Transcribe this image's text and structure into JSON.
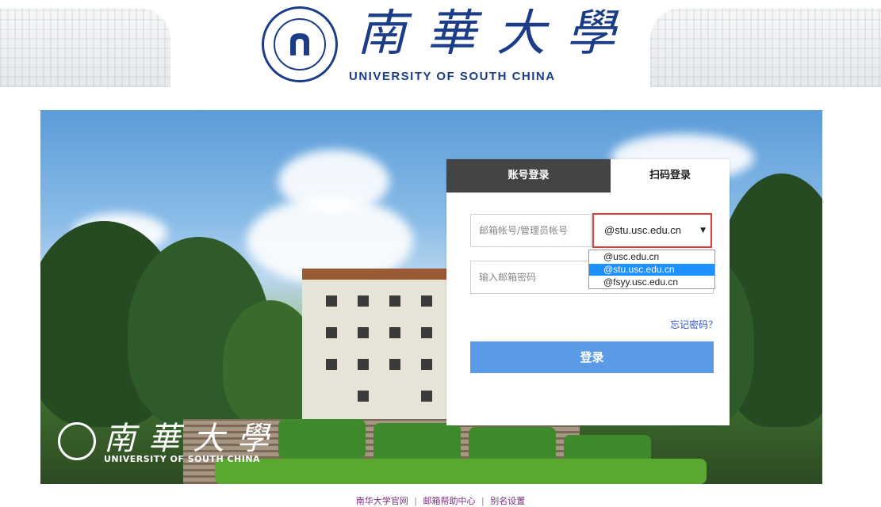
{
  "header": {
    "title_cn": "南華大學",
    "title_en": "UNIVERSITY OF SOUTH CHINA",
    "brand_color": "#1b3d88"
  },
  "hero": {
    "title_cn": "南華大學",
    "title_en": "UNIVERSITY OF SOUTH CHINA"
  },
  "login": {
    "tabs": [
      {
        "label": "账号登录",
        "active": true
      },
      {
        "label": "扫码登录",
        "active": false
      }
    ],
    "username_placeholder": "邮箱帐号/管理员帐号",
    "password_placeholder": "输入邮箱密码",
    "domain_selected": "@stu.usc.edu.cn",
    "domain_options": [
      "@usc.edu.cn",
      "@stu.usc.edu.cn",
      "@fsyy.usc.edu.cn"
    ],
    "forgot_label": "忘记密码？",
    "submit_label": "登录",
    "button_color": "#5b9ae6",
    "highlight_color": "#e03a3a"
  },
  "footer": {
    "links": [
      "南华大学官网",
      "邮箱帮助中心",
      "别名设置"
    ]
  }
}
